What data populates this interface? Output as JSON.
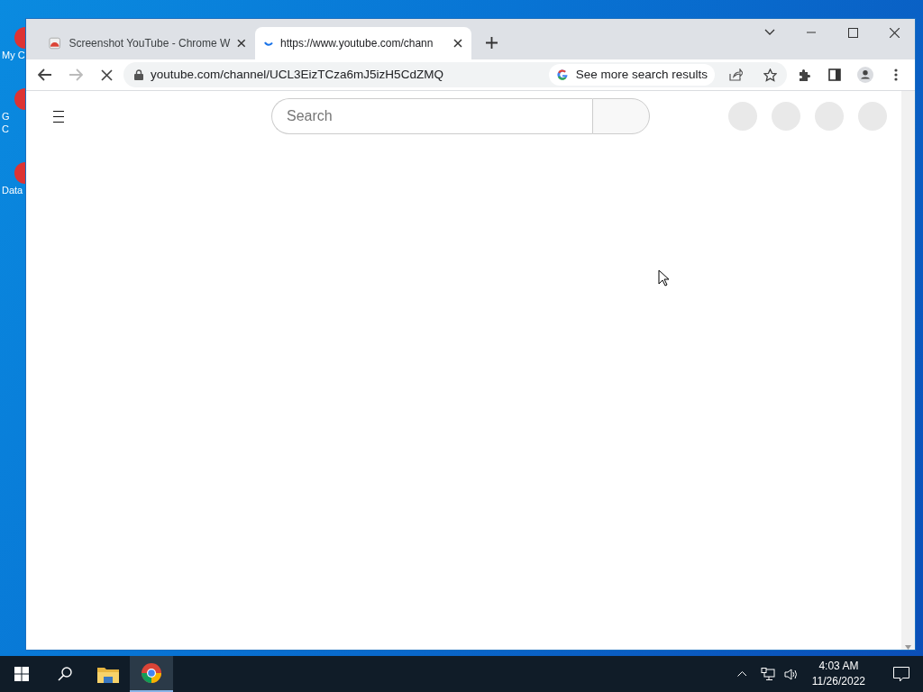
{
  "desktop_icons": [
    {
      "lines": [
        "My C"
      ]
    },
    {
      "lines": [
        "G",
        "C"
      ]
    },
    {
      "lines": [
        "Data"
      ]
    }
  ],
  "tabs": [
    {
      "title": "Screenshot YouTube - Chrome W",
      "selected": false,
      "loading": false
    },
    {
      "title": "https://www.youtube.com/chann",
      "selected": true,
      "loading": true
    }
  ],
  "toolbar": {
    "address": "youtube.com/channel/UCL3EizTCza6mJ5izH5CdZMQ",
    "loading": true,
    "search_chip": "See more search results"
  },
  "page": {
    "search": {
      "placeholder": "Search"
    }
  },
  "taskbar": {
    "time": "4:03 AM",
    "date": "11/26/2022",
    "apps": [
      {
        "kind": "explorer",
        "selected": false
      },
      {
        "kind": "chrome",
        "selected": true
      }
    ]
  }
}
